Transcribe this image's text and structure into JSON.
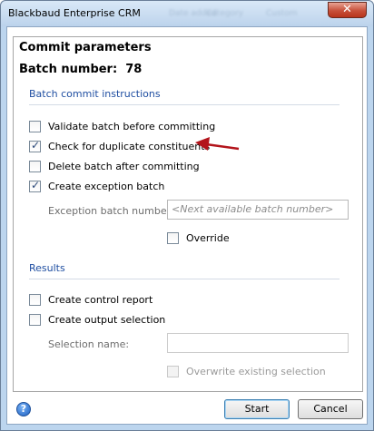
{
  "window": {
    "title": "Blackbaud Enterprise CRM",
    "background_tabs": [
      "Date added",
      "Category",
      "Custom"
    ],
    "close_label": "✕"
  },
  "dialog": {
    "heading": "Commit parameters",
    "batch_number_label": "Batch number:",
    "batch_number_value": "78",
    "instructions_section": {
      "title": "Batch commit instructions",
      "options": [
        {
          "label": "Validate batch before committing",
          "checked": false
        },
        {
          "label": "Check for duplicate constituents",
          "checked": true
        },
        {
          "label": "Delete batch after committing",
          "checked": false
        },
        {
          "label": "Create exception batch",
          "checked": true
        }
      ],
      "exception_batch_number_label": "Exception batch number:",
      "exception_batch_number_placeholder": "<Next available batch number>",
      "override_label": "Override",
      "override_checked": false
    },
    "results_section": {
      "title": "Results",
      "options": [
        {
          "label": "Create control report",
          "checked": false
        },
        {
          "label": "Create output selection",
          "checked": false
        }
      ],
      "selection_name_label": "Selection name:",
      "selection_name_value": "",
      "overwrite_label": "Overwrite existing selection",
      "overwrite_checked": false
    },
    "buttons": {
      "start": "Start",
      "cancel": "Cancel"
    },
    "help_icon": "question-mark-icon",
    "annotation": {
      "color": "#b3141b",
      "points_to": "Check for duplicate constituents"
    }
  }
}
